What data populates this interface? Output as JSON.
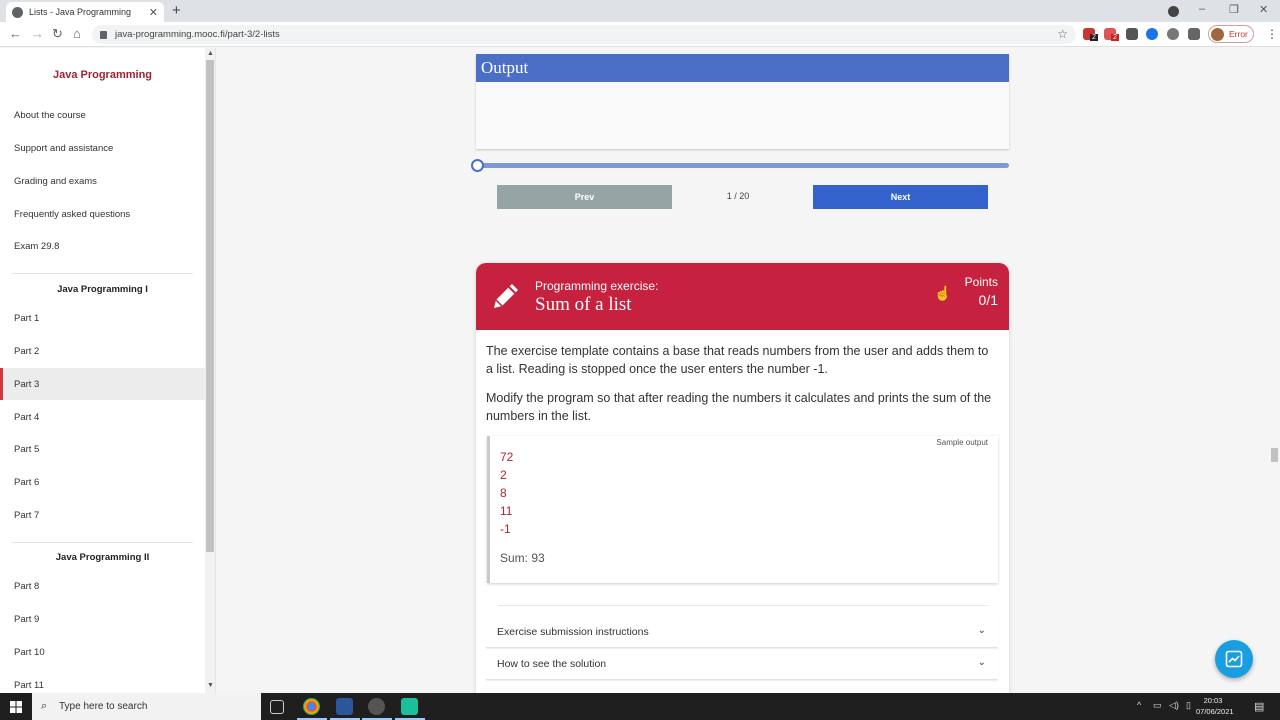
{
  "browser": {
    "tab_title": "Lists - Java Programming",
    "tab_close": "✕",
    "new_tab": "+",
    "url": "java-programming.mooc.fi/part-3/2-lists",
    "error_label": "Error",
    "ext_badge_1": "2",
    "ext_badge_2": "2",
    "window_controls": {
      "minimize": "–",
      "restore": "❐",
      "close": "✕"
    }
  },
  "sidebar": {
    "title": "Java Programming",
    "top_items": [
      {
        "label": "About the course"
      },
      {
        "label": "Support and assistance"
      },
      {
        "label": "Grading and exams"
      },
      {
        "label": "Frequently asked questions"
      },
      {
        "label": "Exam 29.8"
      }
    ],
    "section1": "Java Programming I",
    "parts1": [
      {
        "label": "Part 1"
      },
      {
        "label": "Part 2"
      },
      {
        "label": "Part 3",
        "active": true
      },
      {
        "label": "Part 4"
      },
      {
        "label": "Part 5"
      },
      {
        "label": "Part 6"
      },
      {
        "label": "Part 7"
      }
    ],
    "section2": "Java Programming II",
    "parts2": [
      {
        "label": "Part 8"
      },
      {
        "label": "Part 9"
      },
      {
        "label": "Part 10"
      },
      {
        "label": "Part 11"
      }
    ]
  },
  "visualizer": {
    "output_title": "Output",
    "prev_label": "Prev",
    "next_label": "Next",
    "step_indicator": "1 / 20",
    "progress": 0.0
  },
  "exercise": {
    "type_label": "Programming exercise:",
    "title": "Sum of a list",
    "points_label": "Points",
    "points_value": "0/1",
    "paragraph1": "The exercise template contains a base that reads numbers from the user and adds them to a list. Reading is stopped once the user enters the number -1.",
    "paragraph2": "Modify the program so that after reading the numbers it calculates and prints the sum of the numbers in the list.",
    "sample_label": "Sample output",
    "sample_inputs": [
      "72",
      "2",
      "8",
      "11",
      "-1"
    ],
    "sample_result": "Sum: 93",
    "accordions": [
      {
        "label": "Exercise submission instructions"
      },
      {
        "label": "How to see the solution"
      }
    ]
  },
  "taskbar": {
    "search_placeholder": "Type here to search",
    "time": "20:03",
    "date": "07/06/2021"
  },
  "colors": {
    "brand_red": "#c6223f",
    "output_blue": "#4b6fc6",
    "next_blue": "#3462cd",
    "prev_grey": "#95a5a6",
    "sidebar_title": "#9b2335"
  }
}
